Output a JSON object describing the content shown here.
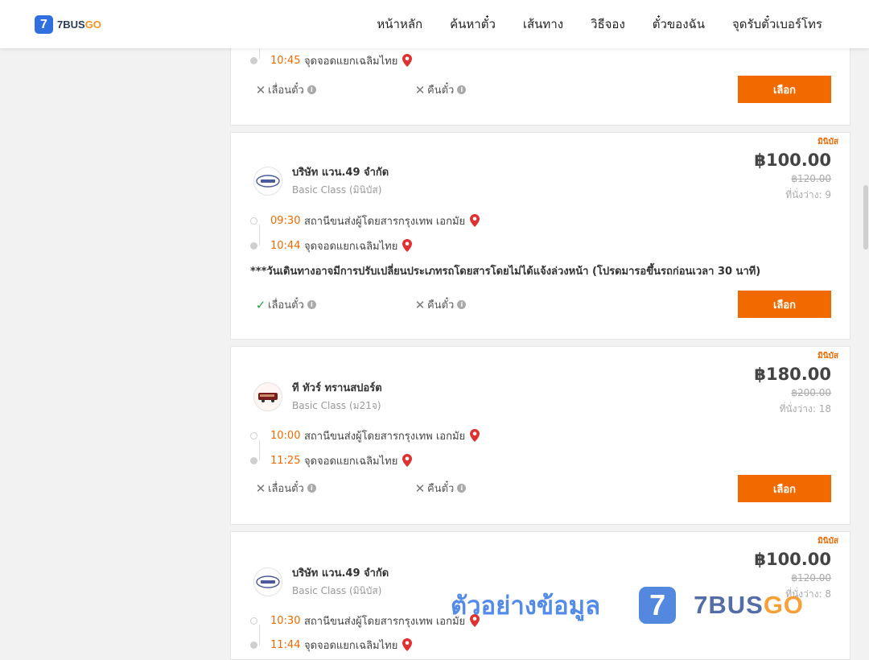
{
  "header": {
    "logo_text": "7BUS",
    "logo_text_accent": "GO",
    "logo_mark": "7",
    "nav": [
      "หน้าหลัก",
      "ค้นหาตั๋ว",
      "เส้นทาง",
      "วิธีจอง",
      "ตั๋วของฉัน",
      "จุดรับตั๋วเบอร์โทร"
    ]
  },
  "top_card": {
    "arrival_time": "10:45",
    "arrival_place": "จุดจอดแยกเฉลิมไทย",
    "change_ticket": "เลื่อนตั๋ว",
    "refund": "คืนตั๋ว",
    "select_label": "เลือก"
  },
  "cards": [
    {
      "badge": "มินิบัส",
      "operator": "บริษัท แวน.49 จำกัด",
      "class": "Basic Class (มินิบัส)",
      "price": "฿100.00",
      "old_price": "฿120.00",
      "seats": "ที่นั่งว่าง: 9",
      "depart_time": "09:30",
      "depart_place": "สถานีขนส่งผู้โดยสารกรุงเทพ เอกมัย",
      "arrive_time": "10:44",
      "arrive_place": "จุดจอดแยกเฉลิมไทย",
      "notice": "***วันเดินทางอาจมีการปรับเปลี่ยนประเภทรถโดยสารโดยไม่ได้แจ้งล่วงหน้า (โปรดมารอขึ้นรถก่อนเวลา 30 นาที)",
      "change_ticket": "เลื่อนตั๋ว",
      "refund": "คืนตั๋ว",
      "select_label": "เลือก"
    },
    {
      "badge": "มินิบัส",
      "operator": "ที ทัวร์ ทรานสปอร์ต",
      "class": "Basic Class (ม21จ)",
      "price": "฿180.00",
      "old_price": "฿200.00",
      "seats": "ที่นั่งว่าง: 18",
      "depart_time": "10:00",
      "depart_place": "สถานีขนส่งผู้โดยสารกรุงเทพ เอกมัย",
      "arrive_time": "11:25",
      "arrive_place": "จุดจอดแยกเฉลิมไทย",
      "change_ticket": "เลื่อนตั๋ว",
      "refund": "คืนตั๋ว",
      "select_label": "เลือก"
    },
    {
      "badge": "มินิบัส",
      "operator": "บริษัท แวน.49 จำกัด",
      "class": "Basic Class (มินิบัส)",
      "price": "฿100.00",
      "old_price": "฿120.00",
      "seats": "ที่นั่งว่าง: 8",
      "depart_time": "10:30",
      "depart_place": "สถานีขนส่งผู้โดยสารกรุงเทพ เอกมัย",
      "arrive_time": "11:44",
      "arrive_place": "จุดจอดแยกเฉลิมไทย"
    }
  ],
  "watermark": {
    "text": "ตัวอย่างข้อมูล",
    "logo_mark": "7",
    "brand": "7BUS",
    "brand_accent": "GO"
  },
  "colors": {
    "accent": "#f06a00",
    "brand_blue": "#2f6fe0",
    "ok_green": "#1fa34a"
  },
  "icons": [
    "location-pin-icon",
    "close-icon",
    "check-icon",
    "info-icon"
  ]
}
